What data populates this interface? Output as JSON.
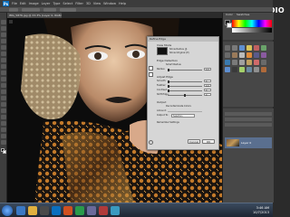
{
  "app": {
    "logo": "Ps",
    "menu": [
      "File",
      "Edit",
      "Image",
      "Layer",
      "Type",
      "Select",
      "Filter",
      "3D",
      "View",
      "Window",
      "Help"
    ]
  },
  "document": {
    "tab_label": "IMG_5876.jpg @ 33.3% (Layer 0, RGB/8)"
  },
  "watermark": "MAGNET STUDIO",
  "right_panels": {
    "color_tabs": [
      "Color",
      "Swatches"
    ],
    "layer_name": "Layer 0"
  },
  "dialog": {
    "title": "Refine Edge",
    "view_mode_label": "View Mode",
    "show_radius": "Show Radius (J)",
    "show_original": "Show Original (P)",
    "edge_detection_label": "Edge Detection",
    "smart_radius": "Smart Radius",
    "radius_label": "Radius:",
    "radius_value": "0.0",
    "adjust_edge_label": "Adjust Edge",
    "smooth_label": "Smooth:",
    "smooth_value": "0",
    "feather_label": "Feather:",
    "feather_value": "0.0",
    "contrast_label": "Contrast:",
    "contrast_value": "0",
    "shift_edge_label": "Shift Edge:",
    "shift_edge_value": "0",
    "output_label": "Output",
    "decontaminate": "Decontaminate Colors",
    "amount_label": "Amount:",
    "output_to_label": "Output To:",
    "output_to_value": "Selection",
    "remember_settings": "Remember Settings",
    "cancel": "Cancel",
    "ok": "OK"
  },
  "taskbar": {
    "time": "3:46 AM",
    "date": "10/7/2013"
  },
  "colors": {
    "ps_blue": "#0a6fbf",
    "dialog_bg": "#d6d6d6",
    "panel_bg": "#474747",
    "layer_selected": "#5a6f8f"
  }
}
